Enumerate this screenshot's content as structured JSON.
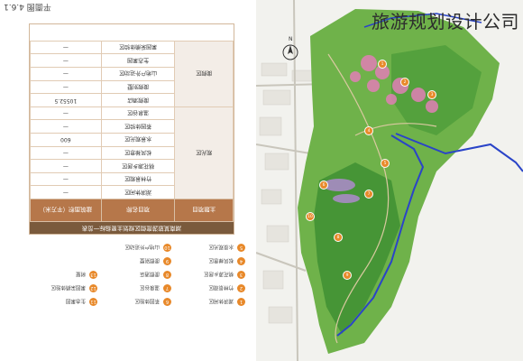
{
  "page_label": "平面图 4.6.1",
  "watermark": "旅游规划设计公司",
  "north": "N",
  "table": {
    "title": "湖南某旅游度假区规划主要指标一览表",
    "headers": [
      "主题项目",
      "项目名称",
      "建筑面积（平方米）"
    ],
    "groups": [
      {
        "zone": "观光区",
        "rows": [
          {
            "name": "湖滨休闲区",
            "area": "—"
          },
          {
            "name": "竹林景观区",
            "area": "—"
          },
          {
            "name": "桃花源乡居区",
            "area": "—"
          },
          {
            "name": "松风禅意区",
            "area": "—"
          },
          {
            "name": "水景观光区",
            "area": "600"
          },
          {
            "name": "茶园体验区",
            "area": "—"
          },
          {
            "name": "温泉谷区",
            "area": "—"
          }
        ]
      },
      {
        "zone": "度假区",
        "rows": [
          {
            "name": "度假酒店",
            "area": "10552.5"
          },
          {
            "name": "度假别墅",
            "area": "—"
          },
          {
            "name": "山地户外运动区",
            "area": "—"
          },
          {
            "name": "生态果园",
            "area": "—"
          },
          {
            "name": "果园采摘体验区",
            "area": "—"
          }
        ]
      }
    ]
  },
  "legend": [
    [
      {
        "num": "1",
        "label": "湖滨休闲区"
      },
      {
        "num": "2",
        "label": "竹林景观区"
      },
      {
        "num": "3",
        "label": "桃花源乡居区"
      },
      {
        "num": "4",
        "label": "松风禅意区"
      },
      {
        "num": "5",
        "label": "水景观光区"
      }
    ],
    [
      {
        "num": "6",
        "label": "茶园体验区"
      },
      {
        "num": "7",
        "label": "温泉谷区"
      },
      {
        "num": "8",
        "label": "度假酒店"
      },
      {
        "num": "9",
        "label": "度假别墅"
      },
      {
        "num": "10",
        "label": "山地户外运动区"
      }
    ],
    [
      {
        "num": "11",
        "label": "生态果园"
      },
      {
        "num": "12",
        "label": "果园采摘体验区"
      },
      {
        "num": "13",
        "label": "树屋"
      }
    ]
  ],
  "colors": {
    "table_header": "#b6774a",
    "map_green": "#5aa23a",
    "map_dark_green": "#2f7a2a",
    "boundary_blue": "#2a44c8",
    "spot_orange": "#e88a2a",
    "pink_flowers": "#e27fb6"
  }
}
